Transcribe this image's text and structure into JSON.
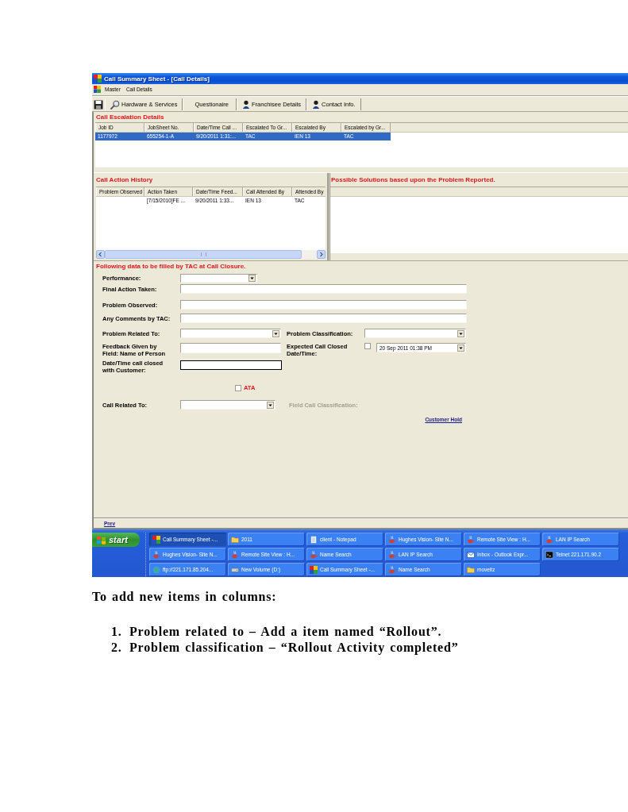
{
  "window": {
    "title": "Call Summary Sheet - [Call Details]"
  },
  "menu": [
    {
      "label": "Master"
    },
    {
      "label": "Call Details"
    }
  ],
  "toolbar": [
    {
      "label": "Hardware & Services",
      "kind": "lookup"
    },
    {
      "label": "Questionaire",
      "kind": "plain"
    },
    {
      "label": "Franchisee Details",
      "kind": "contact"
    },
    {
      "label": "Contact Info.",
      "kind": "contact"
    }
  ],
  "escalation": {
    "title": "Call Escalation Details",
    "columns": [
      "Job ID",
      "JobSheet No.",
      "Date/Time Call ...",
      "Escalated To Gr...",
      "Escalated By",
      "Escalated by Gr..."
    ],
    "rows": [
      {
        "selected": true,
        "cells": [
          "1177972",
          "655254-1-A",
          "9/20/2011 1:31:...",
          "TAC",
          "IEN 13",
          "TAC"
        ]
      }
    ]
  },
  "history": {
    "title": "Call Action History",
    "columns": [
      "Problem Observed",
      "Action Taken",
      "Date/Time Feed...",
      "Call Attended By",
      "Attended By"
    ],
    "rows": [
      {
        "selected": false,
        "cells": [
          null,
          "[7/15/2010]FE ...",
          "9/20/2011 1:33...",
          "IEN 13",
          "TAC"
        ]
      }
    ]
  },
  "solutions": {
    "title": "Possible Solutions based upon the Problem Reported."
  },
  "form": {
    "heading": "Following data to be filled by TAC at Call Closure.",
    "performance": {
      "label": "Performance:"
    },
    "final_action_taken": {
      "label": "Final Action Taken:"
    },
    "problem_observed": {
      "label": "Problem Observed:"
    },
    "comments": {
      "label": "Any Comments by TAC:"
    },
    "problem_related_to": {
      "label": "Problem Related To:"
    },
    "problem_classification": {
      "label": "Problem Classification:"
    },
    "feedback_given_by": {
      "label": "Feedback Given by\nField: Name of Person"
    },
    "expected_closed": {
      "label": "Expected Call Closed\nDate/Time:",
      "checked": false,
      "value": "20 Sep 2011 01:38 PM"
    },
    "closed_with_customer": {
      "label": "Date/Time call closed\nwith Customer:",
      "focused": true
    },
    "ata": {
      "label": "ATA",
      "checked": false
    },
    "call_related_to": {
      "label": "Call Related To:"
    },
    "field_call_classification": {
      "label": "Field Call Classification:",
      "disabled": true
    },
    "customer_hold": {
      "label": "Customer Hold"
    }
  },
  "footer": {
    "link": "Prev"
  },
  "taskbar": {
    "start": "start",
    "buttons": [
      {
        "label": "Call Summary Sheet -...",
        "kind": "app",
        "selected": true
      },
      {
        "label": "2011",
        "kind": "folder",
        "selected": false
      },
      {
        "label": "client - Notepad",
        "kind": "notepad",
        "selected": false
      },
      {
        "label": "Hughes Vision- Site N...",
        "kind": "cup",
        "selected": false
      },
      {
        "label": "Remote Site View : H...",
        "kind": "cup",
        "selected": false
      },
      {
        "label": "LAN IP Search",
        "kind": "cup",
        "selected": false
      },
      {
        "label": "Hughes Vision- Site N...",
        "kind": "cup",
        "selected": false
      },
      {
        "label": "Remote Site View : H...",
        "kind": "cup",
        "selected": false
      },
      {
        "label": "Name Search",
        "kind": "cup",
        "selected": false
      },
      {
        "label": "LAN IP Search",
        "kind": "cup",
        "selected": false
      },
      {
        "label": "Inbox - Outlook Expr...",
        "kind": "mail",
        "selected": false
      },
      {
        "label": "Telnet 221.171.90.2",
        "kind": "console",
        "selected": false
      },
      {
        "label": "ftp://221.171.85.204...",
        "kind": "globe",
        "selected": false
      },
      {
        "label": "New Volume (D:)",
        "kind": "drive",
        "selected": false
      },
      {
        "label": "Call Summary Sheet -...",
        "kind": "app",
        "selected": false
      },
      {
        "label": "Name Search",
        "kind": "cup",
        "selected": false
      },
      {
        "label": "moveitz",
        "kind": "folder",
        "selected": false
      }
    ]
  },
  "instructions": {
    "heading": "To add new items in columns:",
    "steps": [
      {
        "number": "1.",
        "text": "Problem related to – Add a item named “Rollout”."
      },
      {
        "number": "2.",
        "text": "Problem classification – “Rollout Activity completed”"
      }
    ]
  }
}
